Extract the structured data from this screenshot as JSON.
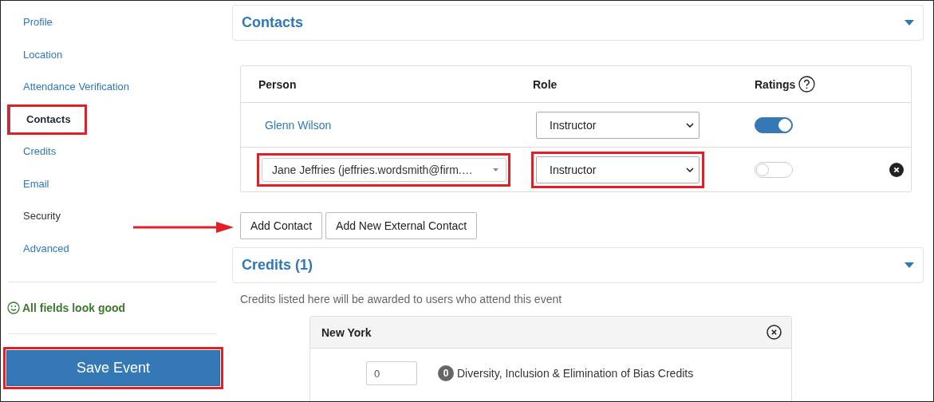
{
  "sidebar": {
    "items": [
      {
        "label": "Profile",
        "selected": false,
        "hovered": false,
        "highlighted": false
      },
      {
        "label": "Location",
        "selected": false,
        "hovered": false,
        "highlighted": false
      },
      {
        "label": "Attendance Verification",
        "selected": false,
        "hovered": false,
        "highlighted": false
      },
      {
        "label": "Contacts",
        "selected": true,
        "hovered": false,
        "highlighted": true
      },
      {
        "label": "Credits",
        "selected": false,
        "hovered": false,
        "highlighted": false
      },
      {
        "label": "Email",
        "selected": false,
        "hovered": false,
        "highlighted": false
      },
      {
        "label": "Security",
        "selected": false,
        "hovered": true,
        "highlighted": false
      },
      {
        "label": "Advanced",
        "selected": false,
        "hovered": false,
        "highlighted": false
      }
    ],
    "status": "All fields look good",
    "save_button": {
      "label": "Save Event",
      "highlighted": true
    }
  },
  "contacts": {
    "title": "Contacts",
    "expanded": true,
    "columns": [
      "Person",
      "Role",
      "Ratings"
    ],
    "rows": [
      {
        "kind": "link",
        "person": "Glenn Wilson",
        "role": "Instructor",
        "ratings_on": true,
        "removable": false,
        "highlighted": false
      },
      {
        "kind": "select",
        "person": "Jane Jeffries (jeffries.wordsmith@firm.…",
        "role": "Instructor",
        "ratings_on": false,
        "removable": true,
        "highlighted": true
      }
    ],
    "buttons": [
      {
        "label": "Add Contact",
        "arrow": true
      },
      {
        "label": "Add New External Contact",
        "arrow": false
      }
    ]
  },
  "credits": {
    "title": "Credits (1)",
    "expanded": true,
    "description": "Credits listed here will be awarded to users who attend this event",
    "region": {
      "title": "New York",
      "items": [
        {
          "value": "0",
          "badge": "0",
          "label": "Diversity, Inclusion & Elimination of Bias Credits"
        }
      ]
    }
  }
}
